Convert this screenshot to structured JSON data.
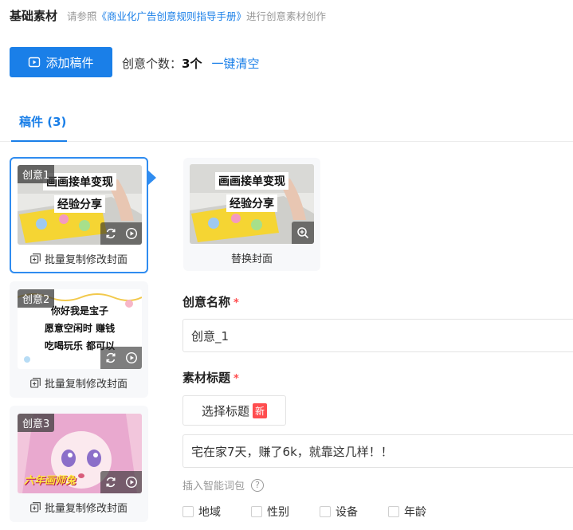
{
  "header": {
    "title": "基础素材",
    "hint_prefix": "请参照",
    "hint_link": "《商业化广告创意规则指导手册》",
    "hint_suffix": "进行创意素材创作"
  },
  "toolbar": {
    "add_label": "添加稿件",
    "count_label": "创意个数：",
    "count_value": "3个",
    "clear_label": "一键清空"
  },
  "tabs": [
    {
      "label": "稿件 (3)",
      "active": true
    }
  ],
  "creatives": [
    {
      "tag": "创意1",
      "line1": "画画接单变现",
      "line2": "经验分享",
      "action": "批量复制修改封面",
      "active": true
    },
    {
      "tag": "创意2",
      "line1": "你好我是宝子",
      "line2": "愿意空闲时 赚钱",
      "line3": "吃喝玩乐 都可以",
      "action": "批量复制修改封面",
      "active": false
    },
    {
      "tag": "创意3",
      "line1": "六年画师兔",
      "action": "批量复制修改封面",
      "active": false
    }
  ],
  "cover": {
    "line1": "画画接单变现",
    "line2": "经验分享",
    "replace_label": "替换封面"
  },
  "form": {
    "name_label": "创意名称",
    "name_value": "创意_1",
    "title_label": "素材标题",
    "select_title_label": "选择标题",
    "new_badge": "新",
    "title_value": "宅在家7天，赚了6k，就靠这几样！！",
    "insert_label": "插入智能词包",
    "help_symbol": "?",
    "options": [
      "地域",
      "性别",
      "设备",
      "年龄"
    ]
  },
  "colors": {
    "accent": "#1a7fe8",
    "required": "#ff4d4f"
  }
}
